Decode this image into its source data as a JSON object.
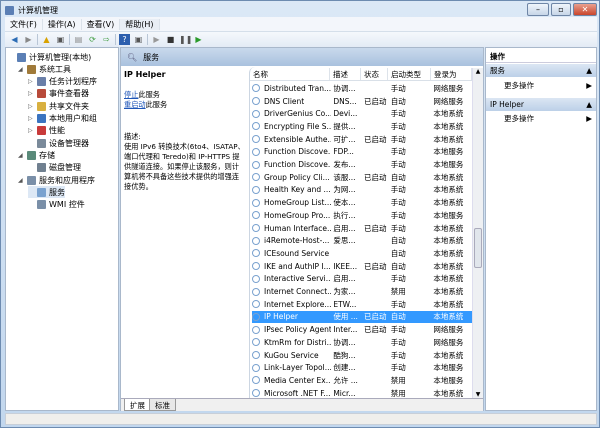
{
  "window": {
    "title": "计算机管理",
    "controls": [
      "minimize",
      "maximize",
      "close"
    ]
  },
  "menu": [
    "文件(F)",
    "操作(A)",
    "查看(V)",
    "帮助(H)"
  ],
  "toolbar": [
    "back-icon",
    "forward-icon",
    "up-icon",
    "show-hide-tree-icon",
    "properties-icon",
    "refresh-icon",
    "export-icon",
    "help-icon",
    "console-icon",
    "play-icon",
    "stop-icon",
    "pause-icon",
    "restart-icon"
  ],
  "tree": [
    {
      "label": "计算机管理(本地)",
      "level": 0,
      "exp": ""
    },
    {
      "label": "系统工具",
      "level": 1,
      "exp": "◢"
    },
    {
      "label": "任务计划程序",
      "level": 2,
      "exp": "▷"
    },
    {
      "label": "事件查看器",
      "level": 2,
      "exp": "▷"
    },
    {
      "label": "共享文件夹",
      "level": 2,
      "exp": "▷"
    },
    {
      "label": "本地用户和组",
      "level": 2,
      "exp": "▷"
    },
    {
      "label": "性能",
      "level": 2,
      "exp": "▷"
    },
    {
      "label": "设备管理器",
      "level": 2,
      "exp": ""
    },
    {
      "label": "存储",
      "level": 1,
      "exp": "◢"
    },
    {
      "label": "磁盘管理",
      "level": 2,
      "exp": ""
    },
    {
      "label": "服务和应用程序",
      "level": 1,
      "exp": "◢"
    },
    {
      "label": "服务",
      "level": 2,
      "exp": "",
      "selected": true
    },
    {
      "label": "WMI 控件",
      "level": 2,
      "exp": ""
    }
  ],
  "middle": {
    "header": "服务",
    "detail": {
      "name": "IP Helper",
      "stop_link": "停止",
      "stop_suffix": "此服务",
      "restart_link": "重启动",
      "restart_suffix": "此服务",
      "desc_label": "描述:",
      "desc": "使用 IPv6 转换技术(6to4、ISATAP、端口代理和 Teredo)和 IP-HTTPS 提供隧道连接。如果停止该服务，则计算机将不具备这些技术提供的增强连接优势。"
    },
    "columns": [
      "名称",
      "描述",
      "状态",
      "启动类型",
      "登录为"
    ],
    "rows": [
      [
        "Distributed Tran...",
        "协调...",
        "",
        "手动",
        "网络服务"
      ],
      [
        "DNS Client",
        "DNS...",
        "已启动",
        "自动",
        "网络服务"
      ],
      [
        "DriverGenius Co...",
        "Devi...",
        "",
        "手动",
        "本地系统"
      ],
      [
        "Encrypting File S...",
        "提供...",
        "",
        "手动",
        "本地系统"
      ],
      [
        "Extensible Authe...",
        "可扩...",
        "已启动",
        "手动",
        "本地系统"
      ],
      [
        "Function Discove...",
        "FDP...",
        "",
        "手动",
        "本地服务"
      ],
      [
        "Function Discove...",
        "发布...",
        "",
        "手动",
        "本地服务"
      ],
      [
        "Group Policy Cli...",
        "该服...",
        "已启动",
        "自动",
        "本地系统"
      ],
      [
        "Health Key and ...",
        "为网...",
        "",
        "手动",
        "本地系统"
      ],
      [
        "HomeGroup List...",
        "使本...",
        "",
        "手动",
        "本地系统"
      ],
      [
        "HomeGroup Pro...",
        "执行...",
        "",
        "手动",
        "本地服务"
      ],
      [
        "Human Interface...",
        "启用...",
        "已启动",
        "手动",
        "本地系统"
      ],
      [
        "i4Remote-Host-...",
        "爱思...",
        "",
        "自动",
        "本地系统"
      ],
      [
        "ICEsound Service",
        "",
        "",
        "自动",
        "本地系统"
      ],
      [
        "IKE and AuthIP I...",
        "IKEE...",
        "已启动",
        "自动",
        "本地系统"
      ],
      [
        "Interactive Servi...",
        "启用...",
        "",
        "手动",
        "本地系统"
      ],
      [
        "Internet Connect...",
        "为家...",
        "",
        "禁用",
        "本地系统"
      ],
      [
        "Internet Explore...",
        "ETW...",
        "",
        "手动",
        "本地系统"
      ],
      [
        "IP Helper",
        "使用 ...",
        "已启动",
        "自动",
        "本地系统"
      ],
      [
        "IPsec Policy Agent",
        "Inter...",
        "已启动",
        "手动",
        "网络服务"
      ],
      [
        "KtmRm for Distri...",
        "协调...",
        "",
        "手动",
        "网络服务"
      ],
      [
        "KuGou Service",
        "酷狗...",
        "",
        "手动",
        "本地系统"
      ],
      [
        "Link-Layer Topol...",
        "创建...",
        "",
        "手动",
        "本地服务"
      ],
      [
        "Media Center Ex...",
        "允许 ...",
        "",
        "禁用",
        "本地服务"
      ],
      [
        "Microsoft .NET F...",
        "Micr...",
        "",
        "禁用",
        "本地系统"
      ]
    ],
    "selected_row": 18,
    "tabs": [
      "扩展",
      "标准"
    ],
    "active_tab": 0
  },
  "actions": {
    "title": "操作",
    "sections": [
      {
        "header": "服务",
        "item": "更多操作"
      },
      {
        "header": "IP Helper",
        "item": "更多操作"
      }
    ]
  }
}
